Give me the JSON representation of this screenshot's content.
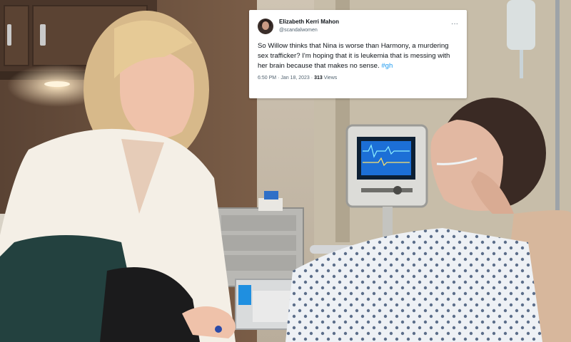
{
  "tweet": {
    "display_name": "Elizabeth Kerri Mahon",
    "handle": "@scandalwomen",
    "text_main": "So Willow thinks that Nina is worse than Harmony, a murdering sex trafficker? I'm hoping that it is leukemia that is messing with her brain because that makes no sense.",
    "hashtag": "#gh",
    "time": "6:50 PM",
    "separator": "·",
    "date": "Jan 18, 2023",
    "views_count": "313",
    "views_label": "Views",
    "more_icon": "more-horizontal-icon"
  },
  "monitor": {
    "screen_color": "#1c6fd6"
  }
}
